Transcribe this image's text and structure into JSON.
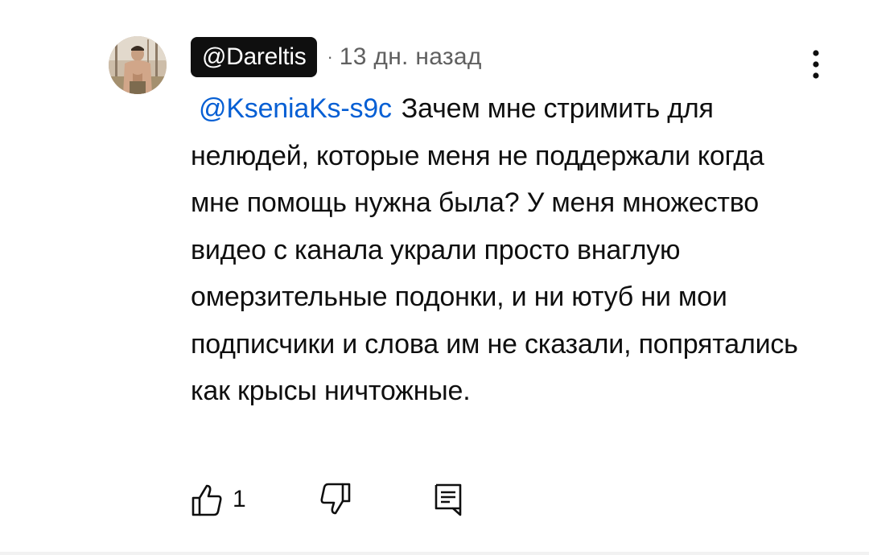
{
  "comment": {
    "author": "@Dareltis",
    "separator": "·",
    "timestamp": "13 дн. назад",
    "mention": "@KseniaKs-s9c",
    "text": "Зачем мне стримить для нелюдей, которые меня не поддержали когда мне помощь нужна была?  У меня множество видео с канала украли просто внаглую омерзительные подонки,  и ни ютуб ни мои подписчики и слова им не сказали, попрятались как крысы ничтожные.",
    "like_count": "1"
  },
  "icons": {
    "avatar": "avatar-photo",
    "menu": "more-vert-icon",
    "like": "thumb-up-icon",
    "dislike": "thumb-down-icon",
    "reply": "comment-reply-icon"
  },
  "colors": {
    "author_chip_bg": "#0f0f0f",
    "mention": "#065fd4",
    "meta": "#606060",
    "text": "#0f0f0f"
  }
}
